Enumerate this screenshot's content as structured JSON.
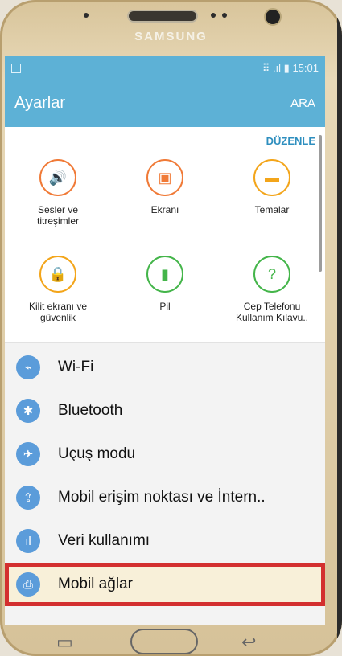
{
  "phone": {
    "brand": "SAMSUNG"
  },
  "status": {
    "time": "15:01",
    "signal": "⠿ .ıl ▮"
  },
  "appbar": {
    "title": "Ayarlar",
    "search": "ARA"
  },
  "quick": {
    "edit": "DÜZENLE",
    "items": [
      {
        "label": "Sesler ve\ntitreşimler",
        "icon": "speaker-icon",
        "color": "#f07a37",
        "glyph": "🔊"
      },
      {
        "label": "Ekranı",
        "icon": "display-icon",
        "color": "#f07a37",
        "glyph": "🖵"
      },
      {
        "label": "Temalar",
        "icon": "theme-icon",
        "color": "#f3a51a",
        "glyph": "🖌"
      },
      {
        "label": "Kilit ekranı ve\ngüvenlik",
        "icon": "lock-icon",
        "color": "#f3a51a",
        "glyph": "🔒"
      },
      {
        "label": "Pil",
        "icon": "battery-icon",
        "color": "#44b54a",
        "glyph": "▮"
      },
      {
        "label": "Cep Telefonu\nKullanım Kılavu..",
        "icon": "help-icon",
        "color": "#44b54a",
        "glyph": "?"
      }
    ]
  },
  "list": {
    "items": [
      {
        "label": "Wi-Fi",
        "icon": "wifi-icon",
        "glyph": "⌁"
      },
      {
        "label": "Bluetooth",
        "icon": "bluetooth-icon",
        "glyph": "✱"
      },
      {
        "label": "Uçuş modu",
        "icon": "airplane-icon",
        "glyph": "✈"
      },
      {
        "label": "Mobil erişim noktası ve İntern..",
        "icon": "hotspot-icon",
        "glyph": "⇪"
      },
      {
        "label": "Veri kullanımı",
        "icon": "data-usage-icon",
        "glyph": "ıl"
      },
      {
        "label": "Mobil ağlar",
        "icon": "mobile-network-icon",
        "glyph": "⎙"
      }
    ]
  },
  "colors": {
    "accent": "#5db1d6",
    "highlight": "#d32f2f"
  }
}
